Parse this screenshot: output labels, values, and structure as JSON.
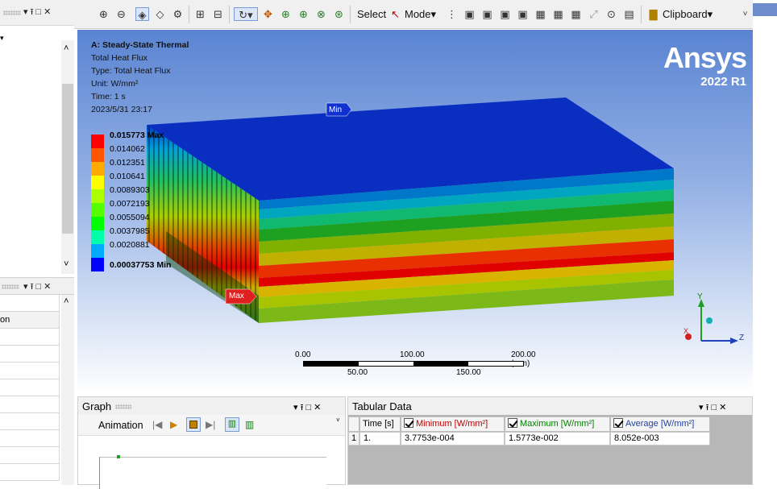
{
  "left_panel": {
    "pin_label": "▾ ⭱ □ ✕",
    "scroll_up": "˄",
    "scroll_down": "˅",
    "mid_pin_label": "▾ ⭱ □ ✕",
    "column_header": "on"
  },
  "toolbar": {
    "select_label": "Select",
    "mode_label": "Mode",
    "clipboard_label": "Clipboard",
    "overflow": "˅"
  },
  "viewport": {
    "analysis_title": "A: Steady-State Thermal",
    "result_name": "Total Heat Flux",
    "result_type": "Type: Total Heat Flux",
    "unit": "Unit: W/mm²",
    "time": "Time: 1 s",
    "timestamp": "2023/5/31 23:17",
    "brand": "Ansys",
    "version": "2022 R1",
    "legend": [
      {
        "label": "0.015773 Max",
        "color": "#ff0000"
      },
      {
        "label": "0.014062",
        "color": "#ff5500"
      },
      {
        "label": "0.012351",
        "color": "#ffaa00"
      },
      {
        "label": "0.010641",
        "color": "#ffff00"
      },
      {
        "label": "0.0089303",
        "color": "#aaff00"
      },
      {
        "label": "0.0072193",
        "color": "#55ff00"
      },
      {
        "label": "0.0055094",
        "color": "#00ff00"
      },
      {
        "label": "0.0037985",
        "color": "#00ffaa"
      },
      {
        "label": "0.0020881",
        "color": "#00aaff"
      },
      {
        "label": "0.00037753 Min",
        "color": "#0000ff"
      }
    ],
    "min_tag": "Min",
    "max_tag": "Max",
    "scale": {
      "top_labels": [
        "0.00",
        "100.00",
        "200.00 (mm)"
      ],
      "bottom_labels": [
        "50.00",
        "150.00"
      ]
    },
    "axes": {
      "y": "Y",
      "z": "Z",
      "x": "X"
    }
  },
  "graph_panel": {
    "title": "Graph",
    "controls": "▾ ⭱ □ ✕",
    "animation_label": "Animation"
  },
  "tabular_panel": {
    "title": "Tabular Data",
    "controls": "▾ ⭱ □ ✕",
    "columns": [
      "Time [s]",
      "Minimum [W/mm²]",
      "Maximum [W/mm²]",
      "Average [W/mm²]"
    ],
    "column_colors": [
      "#000000",
      "#c00000",
      "#008000",
      "#1f3fa8"
    ],
    "rows": [
      {
        "index": "1",
        "time": "1.",
        "min": "3.7753e-004",
        "max": "1.5773e-002",
        "avg": "8.052e-003"
      }
    ]
  }
}
